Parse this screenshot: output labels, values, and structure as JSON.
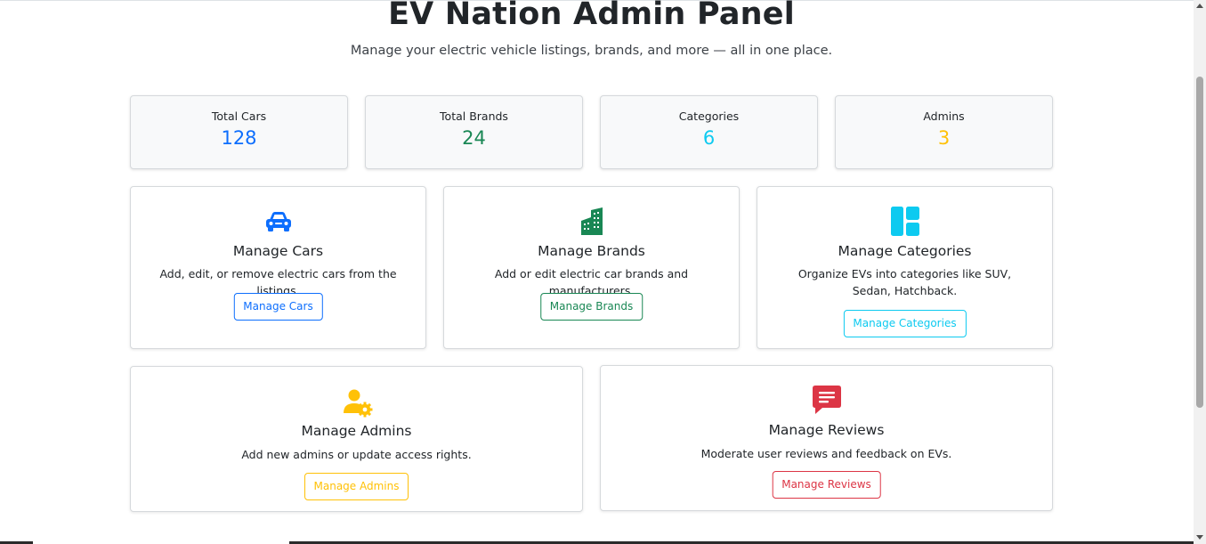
{
  "header": {
    "title": "EV Nation Admin Panel",
    "subtitle": "Manage your electric vehicle listings, brands, and more — all in one place."
  },
  "stats": [
    {
      "label": "Total Cars",
      "value": "128",
      "color": "#0d6efd"
    },
    {
      "label": "Total Brands",
      "value": "24",
      "color": "#198754"
    },
    {
      "label": "Categories",
      "value": "6",
      "color": "#0dcaf0"
    },
    {
      "label": "Admins",
      "value": "3",
      "color": "#ffc107"
    }
  ],
  "features": {
    "cars": {
      "icon": "car-icon",
      "title": "Manage Cars",
      "desc": "Add, edit, or remove electric cars from the listings.",
      "button": "Manage Cars",
      "color": "#0d6efd"
    },
    "brands": {
      "icon": "building-icon",
      "title": "Manage Brands",
      "desc": "Add or edit electric car brands and manufacturers.",
      "button": "Manage Brands",
      "color": "#198754"
    },
    "categories": {
      "icon": "dashboard-layout-icon",
      "title": "Manage Categories",
      "desc": "Organize EVs into categories like SUV, Sedan, Hatchback.",
      "button": "Manage Categories",
      "color": "#0dcaf0"
    },
    "admins": {
      "icon": "user-gear-icon",
      "title": "Manage Admins",
      "desc": "Add new admins or update access rights.",
      "button": "Manage Admins",
      "color": "#ffc107"
    },
    "reviews": {
      "icon": "chat-text-icon",
      "title": "Manage Reviews",
      "desc": "Moderate user reviews and feedback on EVs.",
      "button": "Manage Reviews",
      "color": "#dc3545"
    }
  }
}
